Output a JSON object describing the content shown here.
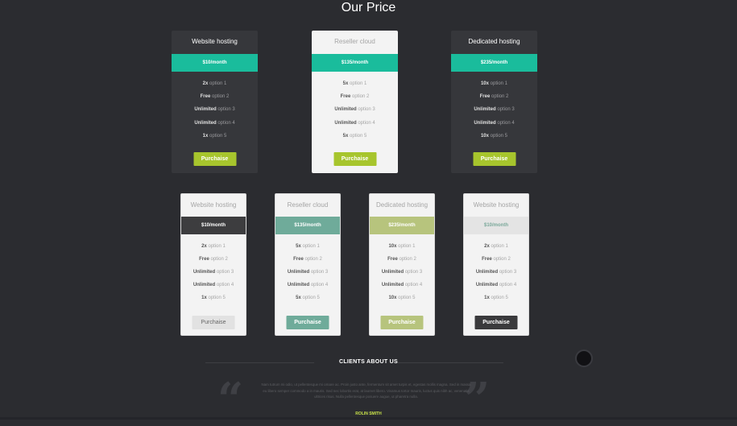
{
  "title": "Our Price",
  "top_plans": [
    {
      "name": "Website hosting",
      "price": "$10/month",
      "options": [
        {
          "bold": "2x",
          "text": " option 1"
        },
        {
          "bold": "Free",
          "text": " option 2"
        },
        {
          "bold": "Unlimited",
          "text": " option 3"
        },
        {
          "bold": "Unlimited",
          "text": " option 4"
        },
        {
          "bold": "1x",
          "text": " option 5"
        }
      ],
      "button": "Purchaise"
    },
    {
      "name": "Reseller cloud",
      "price": "$135/month",
      "options": [
        {
          "bold": "5x",
          "text": " option 1"
        },
        {
          "bold": "Free",
          "text": " option 2"
        },
        {
          "bold": "Unlimited",
          "text": " option 3"
        },
        {
          "bold": "Unlimited",
          "text": " option 4"
        },
        {
          "bold": "5x",
          "text": " option 5"
        }
      ],
      "button": "Purchaise"
    },
    {
      "name": "Dedicated hosting",
      "price": "$235/month",
      "options": [
        {
          "bold": "10x",
          "text": " option 1"
        },
        {
          "bold": "Free",
          "text": " option 2"
        },
        {
          "bold": "Unlimited",
          "text": " option 3"
        },
        {
          "bold": "Unlimited",
          "text": " option 4"
        },
        {
          "bold": "10x",
          "text": " option 5"
        }
      ],
      "button": "Purchaise"
    }
  ],
  "bottom_plans": [
    {
      "name": "Website hosting",
      "price": "$10/month",
      "options": [
        {
          "bold": "2x",
          "text": " option 1"
        },
        {
          "bold": "Free",
          "text": " option 2"
        },
        {
          "bold": "Unlimited",
          "text": " option 3"
        },
        {
          "bold": "Unlimited",
          "text": " option 4"
        },
        {
          "bold": "1x",
          "text": " option 5"
        }
      ],
      "button": "Purchaise"
    },
    {
      "name": "Reseller cloud",
      "price": "$135/month",
      "options": [
        {
          "bold": "5x",
          "text": " option 1"
        },
        {
          "bold": "Free",
          "text": " option 2"
        },
        {
          "bold": "Unlimited",
          "text": " option 3"
        },
        {
          "bold": "Unlimited",
          "text": " option 4"
        },
        {
          "bold": "5x",
          "text": " option 5"
        }
      ],
      "button": "Purchaise"
    },
    {
      "name": "Dedicated hosting",
      "price": "$235/month",
      "options": [
        {
          "bold": "10x",
          "text": " option 1"
        },
        {
          "bold": "Free",
          "text": " option 2"
        },
        {
          "bold": "Unlimited",
          "text": " option 3"
        },
        {
          "bold": "Unlimited",
          "text": " option 4"
        },
        {
          "bold": "10x",
          "text": " option 5"
        }
      ],
      "button": "Purchaise"
    },
    {
      "name": "Website hosting",
      "price": "$10/month",
      "options": [
        {
          "bold": "2x",
          "text": " option 1"
        },
        {
          "bold": "Free",
          "text": " option 2"
        },
        {
          "bold": "Unlimited",
          "text": " option 3"
        },
        {
          "bold": "Unlimited",
          "text": " option 4"
        },
        {
          "bold": "1x",
          "text": " option 5"
        }
      ],
      "button": "Purchaise"
    }
  ],
  "clients": {
    "title": "CLIENTS ABOUT US",
    "quote_open": "“",
    "quote_close": "”",
    "text": "Nam tutrum mi odio, ut pellentesque mi ornare ac. Proin justo ante, fermentum sit amet turpis et, egestas mollis magna. Sed in massa eu libero semper commodo a in mauris. Sed nec lobortis erat, at laoreet libero. Vivamus tortor mauris, luctus quis nibh ac, venenatis ultrices risus. Nulla pellentesque posuere augue, ut pharetra nulla.",
    "author": "ROLIN SMITH"
  },
  "colors": {
    "background": "#2b2c30",
    "accent_teal": "#1abc9c",
    "button_green": "#a7c52d",
    "bottom_price_bgs": [
      "#3d3d3f",
      "#6fab9a",
      "#b7c47d",
      "#e4e4e4"
    ],
    "bottom_button_bgs": [
      "#e2e2e2",
      "#6fab9a",
      "#b7c47d",
      "#3a3a3c"
    ]
  }
}
